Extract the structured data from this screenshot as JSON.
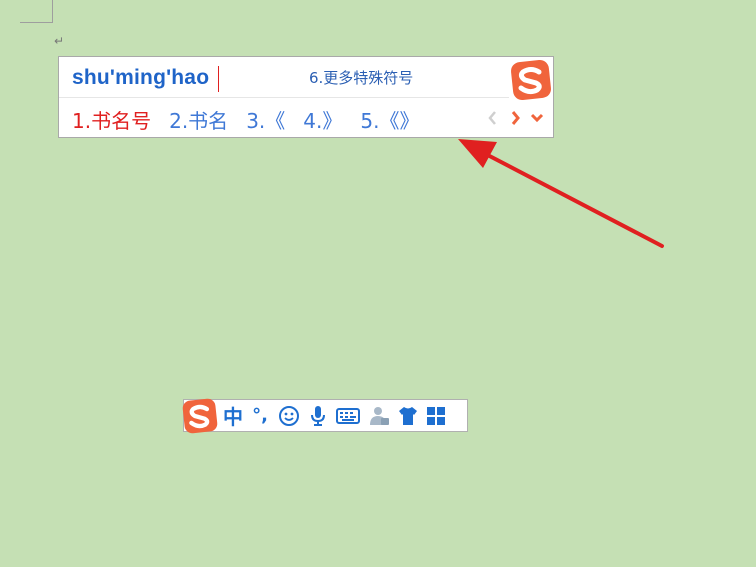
{
  "candidate_window": {
    "pinyin": "shu'ming'hao",
    "hint": "6.更多特殊符号",
    "candidates": [
      "1.书名号",
      "2.书名",
      "3.《",
      "4.》",
      "5.《》"
    ],
    "logo_icon": "sogou-logo-icon",
    "pager": [
      "prev-page-icon",
      "next-page-icon",
      "expand-icon"
    ]
  },
  "status_bar": {
    "logo_icon": "sogou-logo-icon",
    "mode_label": "中",
    "punct_label": "°,",
    "icons": [
      "emoji-icon",
      "microphone-icon",
      "keyboard-icon",
      "user-icon",
      "skin-icon",
      "toolbox-icon"
    ]
  },
  "colors": {
    "background": "#c5e0b4",
    "selected_candidate": "#e02020",
    "candidate": "#3f78d6",
    "arrow": "#e02020",
    "logo": "#f0643c"
  }
}
